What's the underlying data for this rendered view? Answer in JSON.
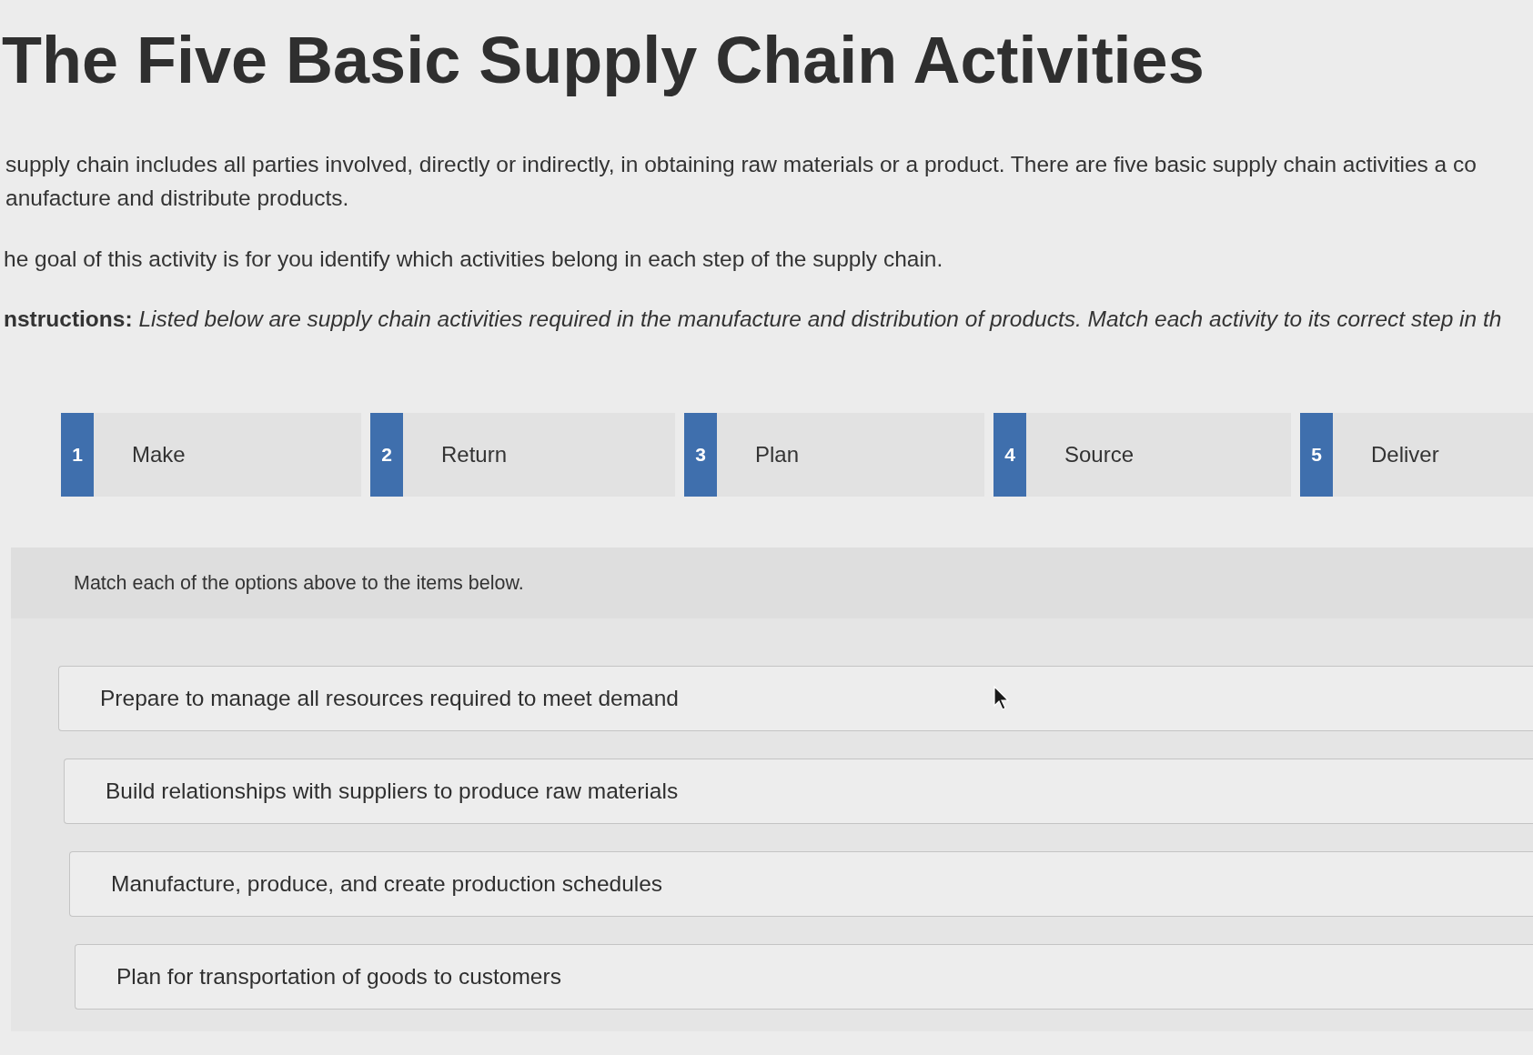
{
  "title": "The Five Basic Supply Chain Activities",
  "intro_lines": [
    "supply chain includes all parties involved, directly or indirectly, in obtaining raw materials or a product. There are five basic supply chain activities a co",
    "anufacture and distribute products."
  ],
  "goal": "he goal of this activity is for you identify which activities belong in each step of the supply chain.",
  "instructions": "**nstructions:** *Listed below are supply chain activities required in the manufacture and distribution of products. Match each activity to its correct step in th*",
  "options": [
    {
      "number": "1",
      "label": "Make"
    },
    {
      "number": "2",
      "label": "Return"
    },
    {
      "number": "3",
      "label": "Plan"
    },
    {
      "number": "4",
      "label": "Source"
    },
    {
      "number": "5",
      "label": "Deliver"
    }
  ],
  "matching": {
    "prompt": "Match each of the options above to the items below.",
    "items": [
      "Prepare to manage all resources required to meet demand",
      "Build relationships with suppliers to produce raw materials",
      "Manufacture, produce, and create production schedules",
      "Plan for transportation of goods to customers"
    ]
  }
}
